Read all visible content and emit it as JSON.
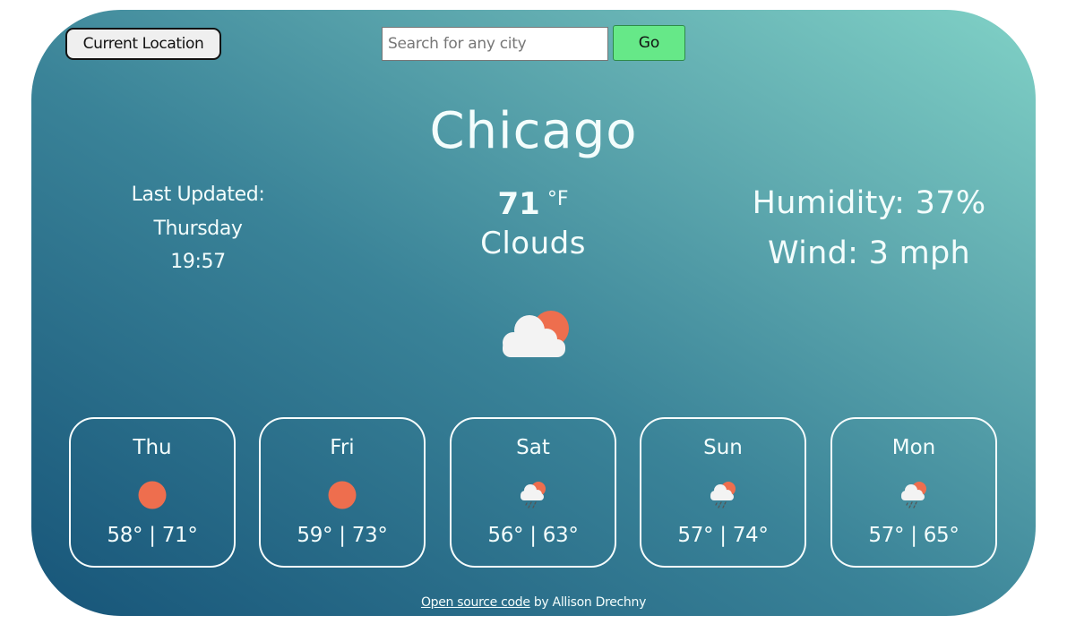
{
  "controls": {
    "current_location_label": "Current Location",
    "search_placeholder": "Search for any city",
    "search_value": "",
    "go_label": "Go"
  },
  "current": {
    "city": "Chicago",
    "last_updated_label": "Last Updated:",
    "last_updated_day": "Thursday",
    "last_updated_time": "19:57",
    "temperature": "71",
    "unit": "°F",
    "condition": "Clouds",
    "condition_icon": "cloud-sun-icon",
    "humidity_text": "Humidity: 37%",
    "wind_text": "Wind: 3 mph"
  },
  "forecast": [
    {
      "day": "Thu",
      "icon": "sun-icon",
      "temps": "58° | 71°"
    },
    {
      "day": "Fri",
      "icon": "sun-icon",
      "temps": "59° | 73°"
    },
    {
      "day": "Sat",
      "icon": "rain-cloud-sun-icon",
      "temps": "56° | 63°"
    },
    {
      "day": "Sun",
      "icon": "rain-cloud-sun-icon",
      "temps": "57° | 74°"
    },
    {
      "day": "Mon",
      "icon": "rain-cloud-sun-icon",
      "temps": "57° | 65°"
    }
  ],
  "footer": {
    "link_text": "Open source code",
    "suffix": " by Allison Drechny"
  },
  "colors": {
    "sun": "#ee6e4e",
    "cloud": "#f3f3f3",
    "go_button": "#66e888",
    "gradient_light": "#80d1c6",
    "gradient_dark": "#175579"
  }
}
